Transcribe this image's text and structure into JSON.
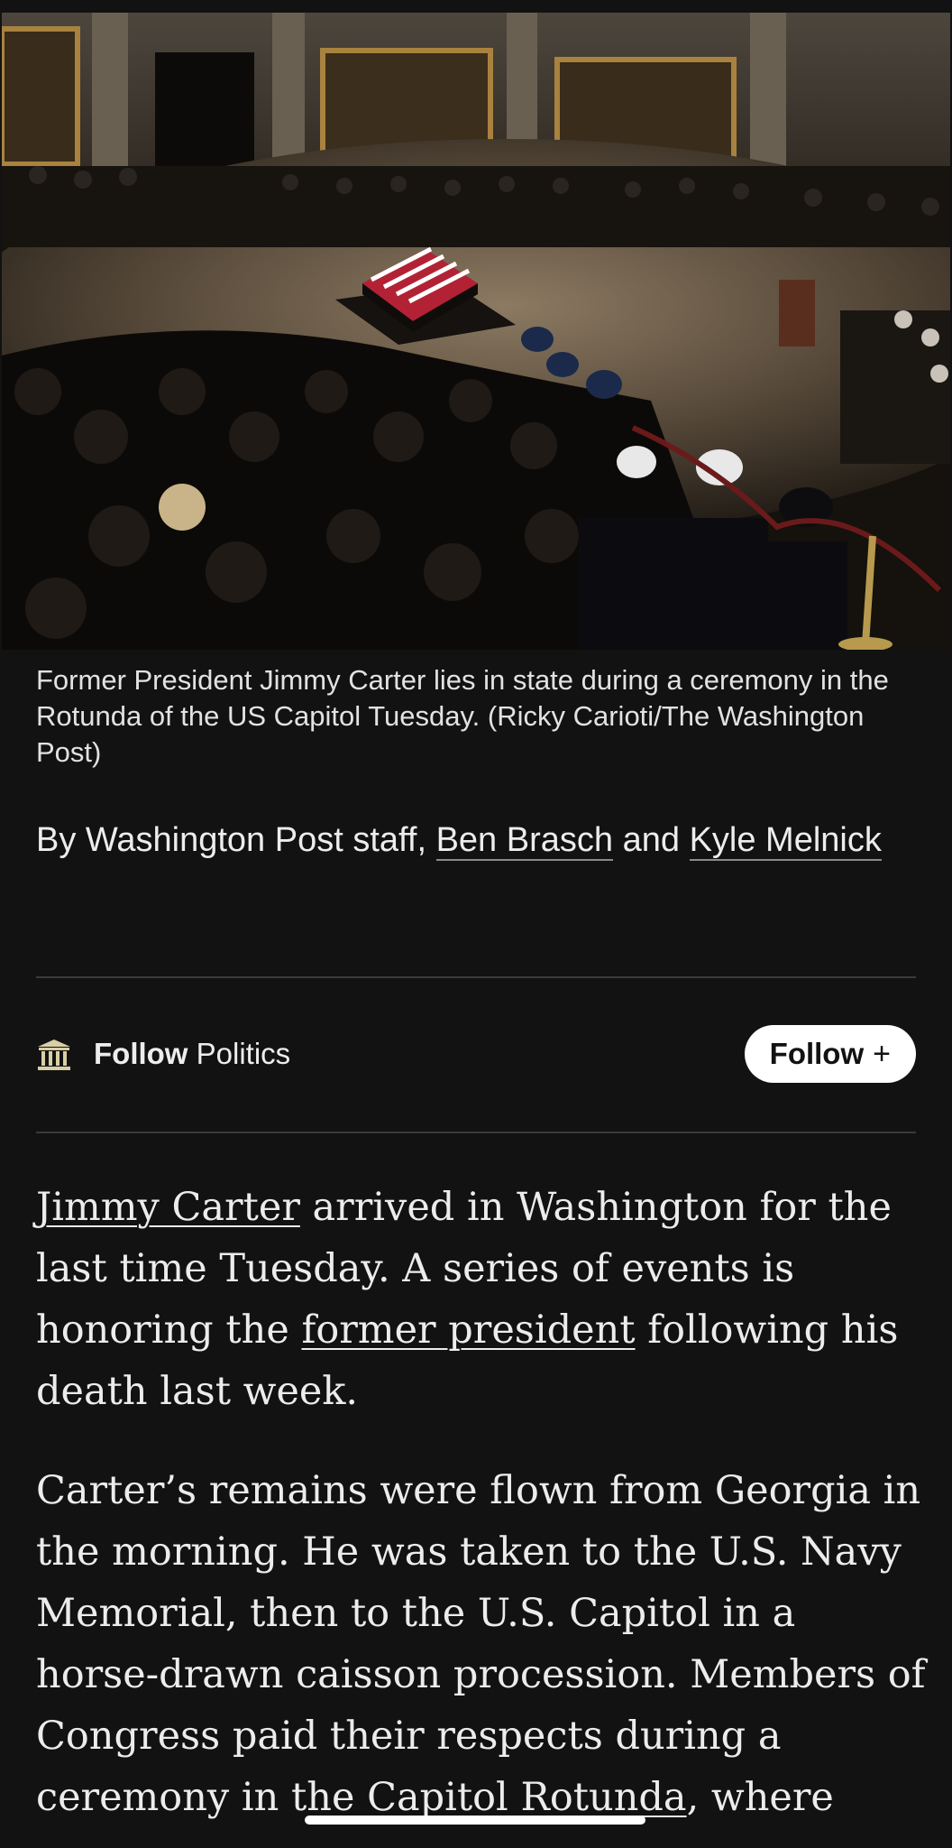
{
  "hero": {
    "caption": "Former President Jimmy Carter lies in state during a ceremony in the Rotunda of the US Capitol Tuesday. (Ricky Carioti/The Washington Post)"
  },
  "byline": {
    "prefix": "By",
    "staff": "Washington Post staff,",
    "author1": "Ben Brasch",
    "and": "and",
    "author2": "Kyle Melnick"
  },
  "follow": {
    "icon": "pillar-icon",
    "label_bold": "Follow",
    "topic": "Politics",
    "button_label": "Follow",
    "button_icon": "+"
  },
  "article": {
    "p1_link": "Jimmy Carter",
    "p1_a": "arrived in Washington for the last time Tuesday. A series of events is honoring the",
    "p1_link2": "former president",
    "p1_b": "following his death last week.",
    "p2_a": "Carter’s remains were flown from Georgia in the morning. He was taken to the U.S. Navy Memorial, then to the U.S. Capitol in a horse-drawn caisson procession. Members of Congress paid their respects during a ceremony in the",
    "p2_link": "Capitol Rotunda",
    "p2_b": ", where"
  },
  "colors": {
    "background": "#121212",
    "text": "#ededed",
    "button_bg": "#ffffff",
    "divider": "#3a3a3a"
  }
}
